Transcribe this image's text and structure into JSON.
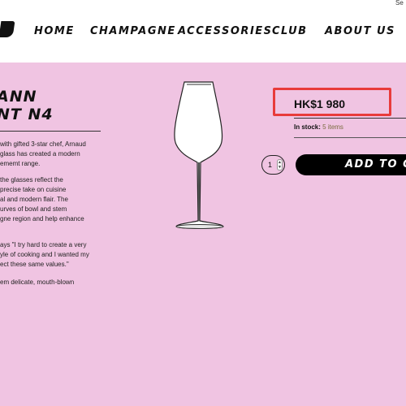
{
  "header": {
    "top_link": "Se",
    "nav": [
      "HOME",
      "CHAMPAGNE",
      "ACCESSORIES",
      "CLUB",
      "ABOUT US"
    ]
  },
  "product": {
    "title_lines": [
      "ANN",
      "NT N4"
    ],
    "description": [
      "with gifted 3-star chef, Arnaud",
      "glass has created a modern",
      "ememt range.",
      "the glasses reflect the",
      "precise take on cuisine",
      "al and modern flair. The",
      "urves of bowl and stem",
      "gne region and help enhance",
      "ays \"I try hard to create a very",
      "yle of cooking and I wanted my",
      "ect these same values.\"",
      "em delicate, mouth-blown"
    ],
    "price": "HK$1 980",
    "stock_label": "In stock:",
    "stock_count": "5 items",
    "quantity": "1",
    "add_to_cart": "ADD TO CA"
  }
}
